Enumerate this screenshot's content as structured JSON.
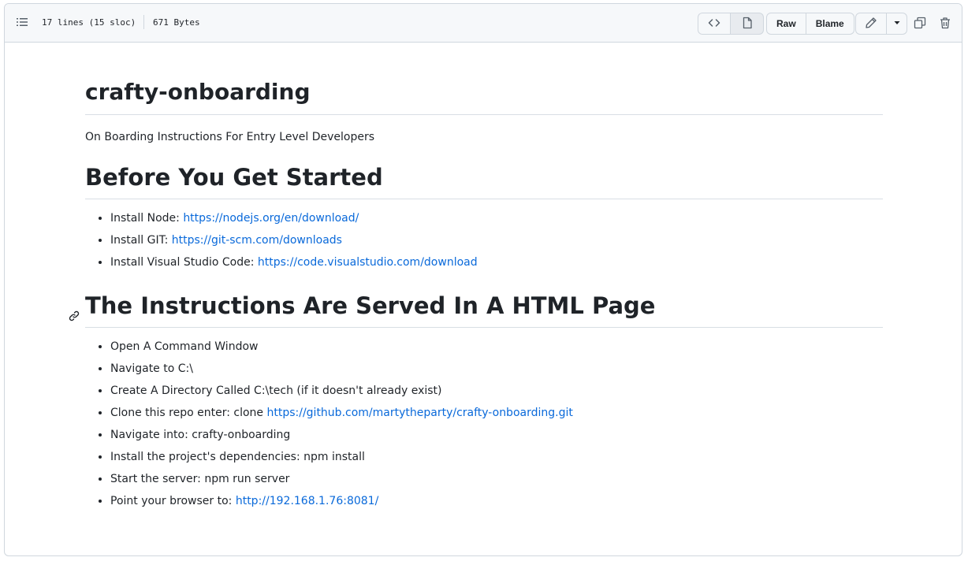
{
  "header": {
    "lines_info": "17 lines (15 sloc)",
    "size_info": "671 Bytes",
    "raw_label": "Raw",
    "blame_label": "Blame"
  },
  "icons": {
    "outline": "list-icon",
    "code_view": "code-icon",
    "preview": "file-icon",
    "edit": "pencil-icon",
    "dropdown": "triangle-down-icon",
    "copy": "copy-icon",
    "delete": "trash-icon",
    "anchor": "link-icon"
  },
  "readme": {
    "title": "crafty-onboarding",
    "intro": "On Boarding Instructions For Entry Level Developers",
    "section1": {
      "heading": "Before You Get Started",
      "items": [
        {
          "text": "Install Node: ",
          "link": "https://nodejs.org/en/download/"
        },
        {
          "text": "Install GIT: ",
          "link": "https://git-scm.com/downloads"
        },
        {
          "text": "Install Visual Studio Code: ",
          "link": "https://code.visualstudio.com/download"
        }
      ]
    },
    "section2": {
      "heading": "The Instructions Are Served In A HTML Page",
      "items": [
        {
          "text": "Open A Command Window",
          "link": ""
        },
        {
          "text": "Navigate to C:\\",
          "link": ""
        },
        {
          "text": "Create A Directory Called C:\\tech (if it doesn't already exist)",
          "link": ""
        },
        {
          "text": "Clone this repo enter: clone ",
          "link": "https://github.com/martytheparty/crafty-onboarding.git"
        },
        {
          "text": "Navigate into: crafty-onboarding",
          "link": ""
        },
        {
          "text": "Install the project's dependencies: npm install",
          "link": ""
        },
        {
          "text": "Start the server: npm run server",
          "link": ""
        },
        {
          "text": "Point your browser to: ",
          "link": "http://192.168.1.76:8081/"
        }
      ]
    }
  },
  "colors": {
    "link": "#0969da",
    "border": "#d0d7de",
    "header_bg": "#f6f8fa"
  }
}
